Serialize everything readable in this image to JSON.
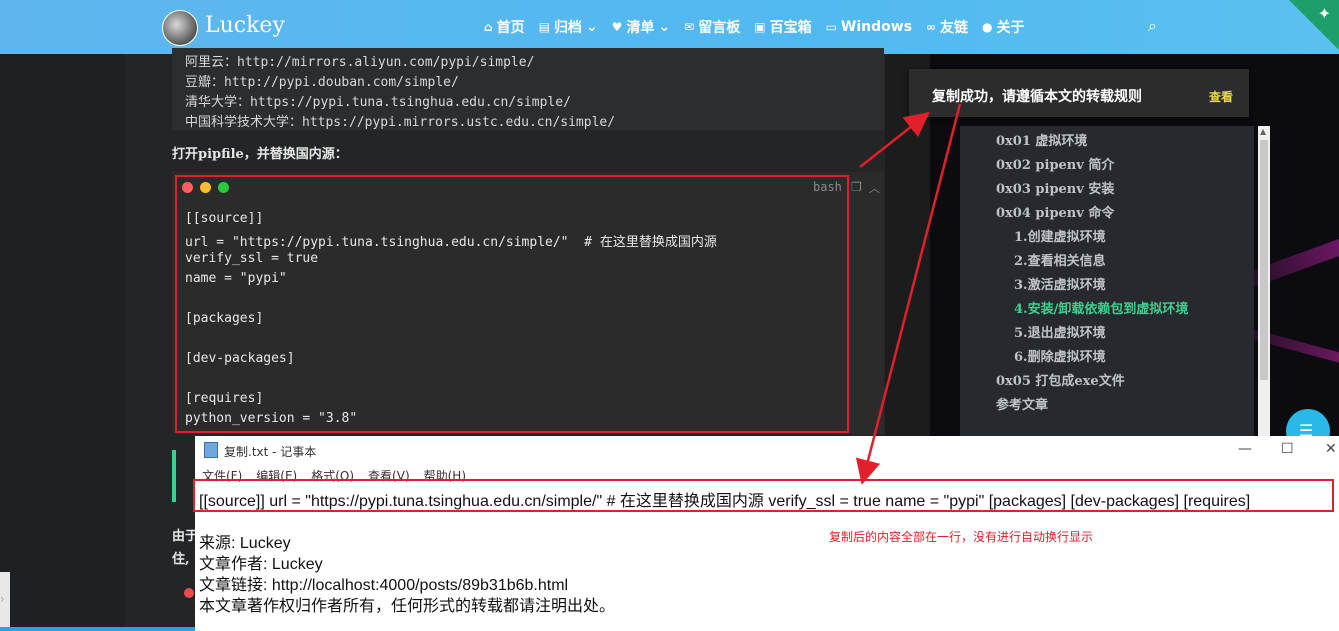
{
  "navbar": {
    "brand": "Luckey",
    "items": [
      {
        "icon": "home-icon",
        "glyph": "⌂",
        "label": "首页",
        "caret": false
      },
      {
        "icon": "archive-icon",
        "glyph": "▤",
        "label": "归档",
        "caret": true
      },
      {
        "icon": "heart-icon",
        "glyph": "♥",
        "label": "清单",
        "caret": true
      },
      {
        "icon": "envelope-icon",
        "glyph": "✉",
        "label": "留言板",
        "caret": false
      },
      {
        "icon": "briefcase-icon",
        "glyph": "▣",
        "label": "百宝箱",
        "caret": false
      },
      {
        "icon": "monitor-icon",
        "glyph": "▭",
        "label": "Windows",
        "caret": false
      },
      {
        "icon": "link-icon",
        "glyph": "∞",
        "label": "友链",
        "caret": false
      },
      {
        "icon": "user-icon",
        "glyph": "●",
        "label": "关于",
        "caret": false
      }
    ]
  },
  "mirrors": [
    "阿里云：http://mirrors.aliyun.com/pypi/simple/",
    "豆瓣：http://pypi.douban.com/simple/",
    "清华大学：https://pypi.tuna.tsinghua.edu.cn/simple/",
    "中国科学技术大学：https://pypi.mirrors.ustc.edu.cn/simple/"
  ],
  "instruction": "打开pipfile，并替换国内源：",
  "code": {
    "lang": "bash",
    "lines": [
      "[[source]]",
      "url = \"https://pypi.tuna.tsinghua.edu.cn/simple/\"  # 在这里替换成国内源",
      "verify_ssl = true",
      "name = \"pypi\"",
      "",
      "[packages]",
      "",
      "[dev-packages]",
      "",
      "[requires]",
      "python_version = \"3.8\""
    ]
  },
  "toast": {
    "message": "复制成功，请遵循本文的转载规则",
    "action": "查看"
  },
  "toc": [
    {
      "label": "0x01 虚拟环境",
      "level": 1,
      "active": false
    },
    {
      "label": "0x02 pipenv 简介",
      "level": 1,
      "active": false
    },
    {
      "label": "0x03 pipenv 安装",
      "level": 1,
      "active": false
    },
    {
      "label": "0x04 pipenv 命令",
      "level": 1,
      "active": false
    },
    {
      "label": "1.创建虚拟环境",
      "level": 2,
      "active": false
    },
    {
      "label": "2.查看相关信息",
      "level": 2,
      "active": false
    },
    {
      "label": "3.激活虚拟环境",
      "level": 2,
      "active": false
    },
    {
      "label": "4.安装/卸载依赖包到虚拟环境",
      "level": 2,
      "active": true
    },
    {
      "label": "5.退出虚拟环境",
      "level": 2,
      "active": false
    },
    {
      "label": "6.删除虚拟环境",
      "level": 2,
      "active": false
    },
    {
      "label": "0x05 打包成exe文件",
      "level": 1,
      "active": false
    },
    {
      "label": "参考文章",
      "level": 1,
      "active": false
    }
  ],
  "notepad": {
    "title": "复制.txt - 记事本",
    "menu": [
      "文件(F)",
      "编辑(E)",
      "格式(O)",
      "查看(V)",
      "帮助(H)"
    ],
    "pasted_line": "[[source]] url = \"https://pypi.tuna.tsinghua.edu.cn/simple/\" # 在这里替换成国内源 verify_ssl = true name = \"pypi\" [packages] [dev-packages] [requires]",
    "attribution": [
      "来源: Luckey",
      "文章作者: Luckey",
      "文章链接: http://localhost:4000/posts/89b31b6b.html",
      "本文章著作权归作者所有，任何形式的转载都请注明出处。"
    ]
  },
  "annotation": "复制后的内容全部在一行，没有进行自动换行显示",
  "cut_text": [
    "由于",
    "住,"
  ],
  "colors": {
    "annotation_red": "#e0202a",
    "toc_active": "#3fcf8e",
    "navbar_blue": "#55b8ef",
    "toast_action": "#e8d84a"
  }
}
